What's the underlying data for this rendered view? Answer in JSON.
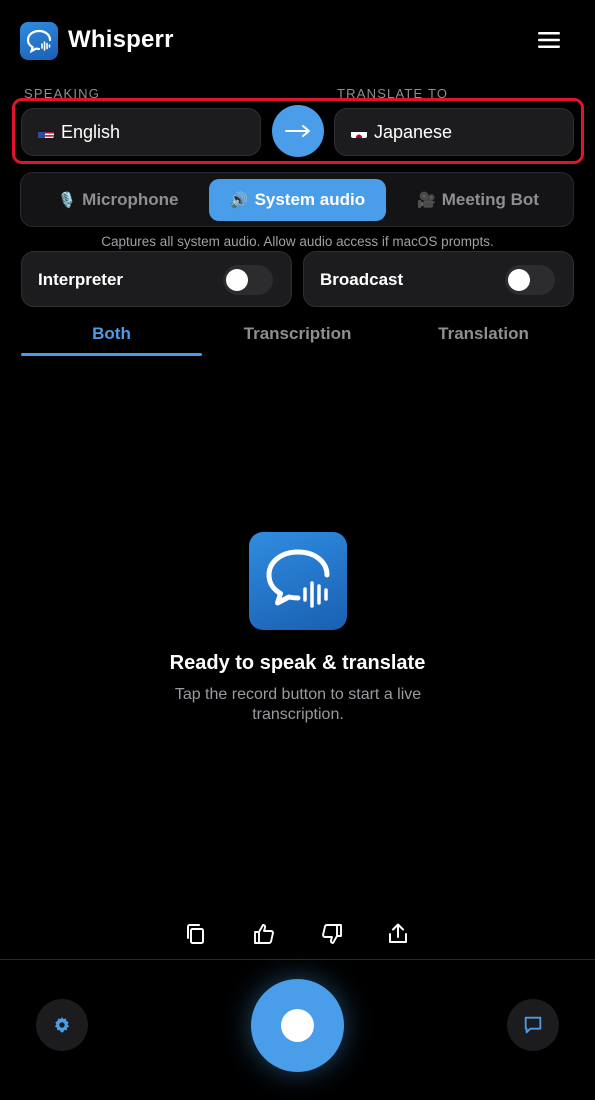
{
  "app": {
    "title": "Whisperr"
  },
  "languages": {
    "speaking_label": "SPEAKING",
    "translate_label": "TRANSLATE TO",
    "source": "English",
    "target": "Japanese",
    "swap_arrow": "→"
  },
  "audio_source": {
    "options": [
      {
        "label": "Microphone",
        "icon": "🎙️"
      },
      {
        "label": "System audio",
        "icon": "🔊"
      },
      {
        "label": "Meeting Bot",
        "icon": "🎥"
      }
    ],
    "selected": "System audio",
    "hint": "Captures all system audio. Allow audio access if macOS prompts."
  },
  "toggles": [
    {
      "label": "Interpreter",
      "on": false
    },
    {
      "label": "Broadcast",
      "on": false
    }
  ],
  "view_tabs": {
    "items": [
      "Both",
      "Transcription",
      "Translation"
    ],
    "selected": "Both"
  },
  "empty_state": {
    "title": "Ready to speak & translate",
    "subtitle": "Tap the record button to start a live transcription."
  },
  "actions": [
    "copy-icon",
    "thumbs-up-icon",
    "thumbs-down-icon",
    "share-icon"
  ],
  "colors": {
    "accent": "#4a9de8",
    "highlight_border": "#e0142c",
    "background": "#000000",
    "card": "#1c1c1e"
  }
}
